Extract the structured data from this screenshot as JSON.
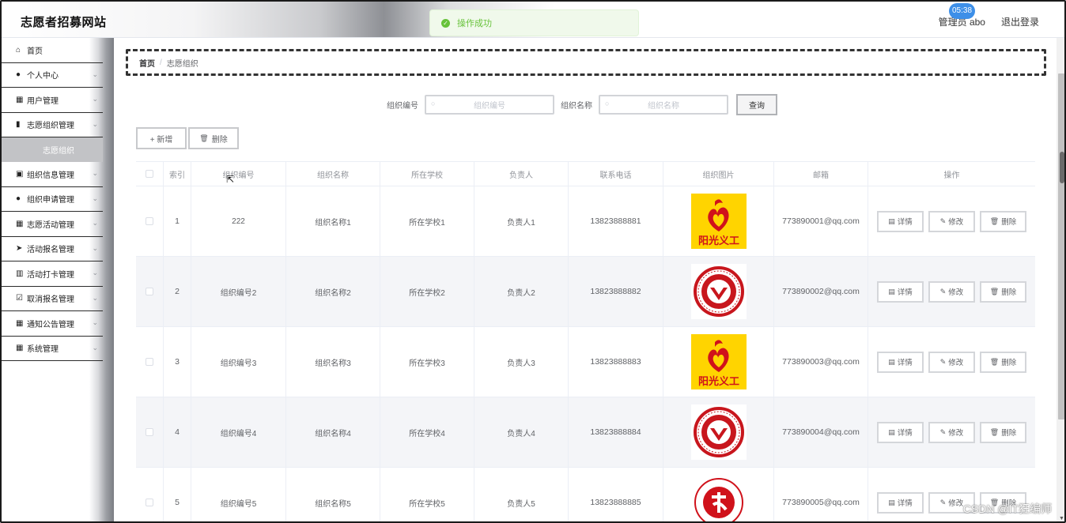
{
  "header": {
    "site_title": "志愿者招募网站",
    "toast": "操作成功",
    "user_text": "管理员 abo",
    "logout": "退出登录",
    "time_badge": "05:38"
  },
  "sidebar": {
    "items": [
      {
        "label": "首页",
        "icon": "home-icon",
        "glyph": "⌂",
        "chevron": false
      },
      {
        "label": "个人中心",
        "icon": "user-icon",
        "glyph": "●",
        "chevron": true
      },
      {
        "label": "用户管理",
        "icon": "grid-icon",
        "glyph": "▦",
        "chevron": true
      },
      {
        "label": "志愿组织管理",
        "icon": "chart-icon",
        "glyph": "▮",
        "chevron": true
      },
      {
        "label": "组织信息管理",
        "icon": "clipboard-icon",
        "glyph": "▣",
        "chevron": true
      },
      {
        "label": "组织申请管理",
        "icon": "user-icon",
        "glyph": "●",
        "chevron": true
      },
      {
        "label": "志愿活动管理",
        "icon": "grid-icon",
        "glyph": "▦",
        "chevron": true
      },
      {
        "label": "活动报名管理",
        "icon": "send-icon",
        "glyph": "➤",
        "chevron": true
      },
      {
        "label": "活动打卡管理",
        "icon": "bar-chart-icon",
        "glyph": "▥",
        "chevron": true
      },
      {
        "label": "取消报名管理",
        "icon": "checkbox-icon",
        "glyph": "☑",
        "chevron": true
      },
      {
        "label": "通知公告管理",
        "icon": "grid-icon",
        "glyph": "▦",
        "chevron": true
      },
      {
        "label": "系统管理",
        "icon": "grid-icon",
        "glyph": "▦",
        "chevron": true
      }
    ],
    "sub_item": "志愿组织"
  },
  "breadcrumb": {
    "home": "首页",
    "sep": "/",
    "current": "志愿组织"
  },
  "search": {
    "code_label": "组织编号",
    "code_placeholder": "组织编号",
    "name_label": "组织名称",
    "name_placeholder": "组织名称",
    "query_btn": "查询"
  },
  "actions": {
    "add": "+ 新增",
    "delete": "删除"
  },
  "table": {
    "headers": [
      "",
      "索引",
      "组织编号",
      "组织名称",
      "所在学校",
      "负责人",
      "联系电话",
      "组织图片",
      "邮箱",
      "操作"
    ],
    "rows": [
      {
        "index": "1",
        "code": "222",
        "name": "组织名称1",
        "school": "所在学校1",
        "leader": "负责人1",
        "phone": "13823888881",
        "logo": "sunshine",
        "email": "773890001@qq.com"
      },
      {
        "index": "2",
        "code": "组织编号2",
        "name": "组织名称2",
        "school": "所在学校2",
        "leader": "负责人2",
        "phone": "13823888882",
        "logo": "seal",
        "email": "773890002@qq.com"
      },
      {
        "index": "3",
        "code": "组织编号3",
        "name": "组织名称3",
        "school": "所在学校3",
        "leader": "负责人3",
        "phone": "13823888883",
        "logo": "sunshine",
        "email": "773890003@qq.com"
      },
      {
        "index": "4",
        "code": "组织编号4",
        "name": "组织名称4",
        "school": "所在学校4",
        "leader": "负责人4",
        "phone": "13823888884",
        "logo": "seal",
        "email": "773890004@qq.com"
      },
      {
        "index": "5",
        "code": "组织编号5",
        "name": "组织名称5",
        "school": "所在学校5",
        "leader": "负责人5",
        "phone": "13823888885",
        "logo": "volunteer",
        "email": "773890005@qq.com"
      }
    ],
    "op_detail": "详情",
    "op_edit": "修改",
    "op_delete": "删除"
  },
  "logo_text": {
    "sunshine": "阳光义工"
  },
  "watermark": "CSDN @IT狂编师",
  "colors": {
    "accent": "#409eff",
    "success": "#67c23a",
    "logo_red": "#d0121b",
    "logo_yellow": "#ffd400"
  }
}
